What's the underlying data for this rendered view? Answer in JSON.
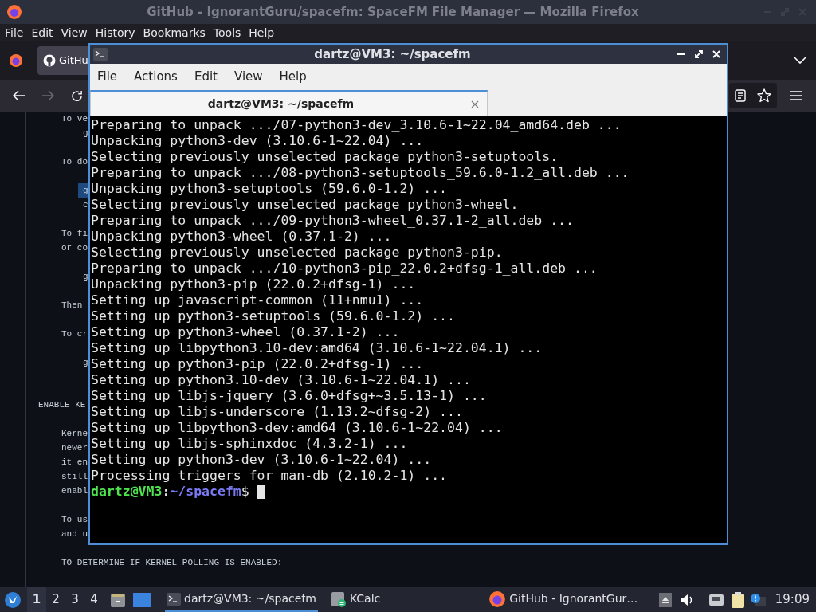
{
  "firefox": {
    "title": "GitHub - IgnorantGuru/spacefm: SpaceFM File Manager — Mozilla Firefox",
    "menu": [
      "File",
      "Edit",
      "View",
      "History",
      "Bookmarks",
      "Tools",
      "Help"
    ],
    "tab": {
      "title": "GitHu"
    },
    "content": [
      [
        {
          "kind": "text",
          "text": "To ve",
          "highlighted": false
        },
        {
          "kind": "code",
          "text": "g",
          "highlighted": false
        }
      ],
      [
        {
          "kind": "text",
          "text": "To do",
          "highlighted": false
        }
      ],
      [
        {
          "kind": "code",
          "text": "g",
          "highlighted": true
        },
        {
          "kind": "code",
          "text": "c",
          "highlighted": false
        }
      ],
      [
        {
          "kind": "text",
          "text": "To fi",
          "highlighted": false
        },
        {
          "kind": "text",
          "text": "or co",
          "highlighted": false
        }
      ],
      [
        {
          "kind": "code",
          "text": "g",
          "highlighted": false
        }
      ],
      [
        {
          "kind": "text",
          "text": "Then",
          "highlighted": false
        }
      ],
      [
        {
          "kind": "text",
          "text": "To cr",
          "highlighted": false
        }
      ],
      [
        {
          "kind": "code",
          "text": "g",
          "highlighted": false
        }
      ],
      [
        {
          "kind": "heading",
          "text": "ENABLE KE",
          "highlighted": false
        }
      ],
      [
        {
          "kind": "text",
          "text": "Kerne",
          "highlighted": false
        },
        {
          "kind": "text",
          "text": "newer",
          "highlighted": false
        },
        {
          "kind": "text",
          "text": "it en",
          "highlighted": false
        },
        {
          "kind": "text",
          "text": "still",
          "highlighted": false
        },
        {
          "kind": "text",
          "text": "enabl",
          "highlighted": false
        }
      ],
      [
        {
          "kind": "text",
          "text": "To us",
          "highlighted": false
        },
        {
          "kind": "text",
          "text": "and u",
          "highlighted": false
        }
      ],
      [
        {
          "kind": "text",
          "text": "TO DETERMINE IF KERNEL POLLING IS ENABLED:",
          "highlighted": false
        }
      ]
    ]
  },
  "terminal": {
    "title": "dartz@VM3: ~/spacefm",
    "menu": [
      "File",
      "Actions",
      "Edit",
      "View",
      "Help"
    ],
    "tab": {
      "title": "dartz@VM3: ~/spacefm"
    },
    "lines": [
      "Preparing to unpack .../07-python3-dev_3.10.6-1~22.04_amd64.deb ...",
      "Unpacking python3-dev (3.10.6-1~22.04) ...",
      "Selecting previously unselected package python3-setuptools.",
      "Preparing to unpack .../08-python3-setuptools_59.6.0-1.2_all.deb ...",
      "Unpacking python3-setuptools (59.6.0-1.2) ...",
      "Selecting previously unselected package python3-wheel.",
      "Preparing to unpack .../09-python3-wheel_0.37.1-2_all.deb ...",
      "Unpacking python3-wheel (0.37.1-2) ...",
      "Selecting previously unselected package python3-pip.",
      "Preparing to unpack .../10-python3-pip_22.0.2+dfsg-1_all.deb ...",
      "Unpacking python3-pip (22.0.2+dfsg-1) ...",
      "Setting up javascript-common (11+nmu1) ...",
      "Setting up python3-setuptools (59.6.0-1.2) ...",
      "Setting up python3-wheel (0.37.1-2) ...",
      "Setting up libpython3.10-dev:amd64 (3.10.6-1~22.04.1) ...",
      "Setting up python3-pip (22.0.2+dfsg-1) ...",
      "Setting up python3.10-dev (3.10.6-1~22.04.1) ...",
      "Setting up libjs-jquery (3.6.0+dfsg+~3.5.13-1) ...",
      "Setting up libjs-underscore (1.13.2~dfsg-2) ...",
      "Setting up libpython3-dev:amd64 (3.10.6-1~22.04) ...",
      "Setting up libjs-sphinxdoc (4.3.2-1) ...",
      "Setting up python3-dev (3.10.6-1~22.04) ...",
      "Processing triggers for man-db (2.10.2-1) ..."
    ],
    "prompt": {
      "user_host": "dartz@VM3",
      "separator": ":",
      "path": "~/spacefm",
      "symbol": "$"
    }
  },
  "taskbar": {
    "workspaces": [
      {
        "label": "1",
        "selected": true
      },
      {
        "label": "2",
        "selected": false
      },
      {
        "label": "3",
        "selected": false
      },
      {
        "label": "4",
        "selected": false
      }
    ],
    "tasks": [
      {
        "kind": "terminal",
        "label": "dartz@VM3: ~/spacefm",
        "active": true
      },
      {
        "kind": "calculator",
        "label": "KCalc",
        "active": false
      },
      {
        "kind": "browser",
        "label": "GitHub - IgnorantGur…",
        "active": false
      }
    ],
    "clock": "19:09"
  }
}
